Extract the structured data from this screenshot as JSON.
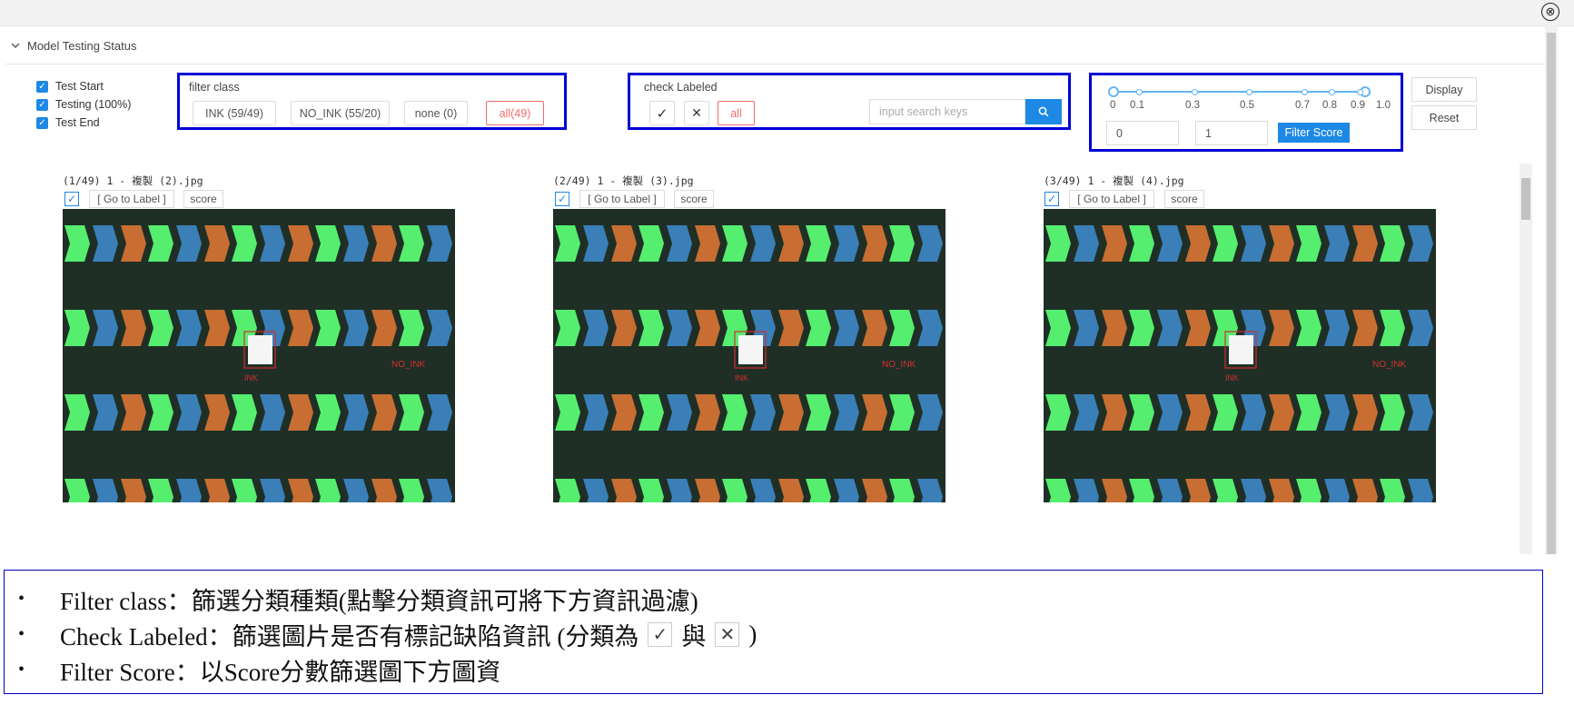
{
  "header": {
    "section_title": "Model Testing Status",
    "close_symbol": "⊗"
  },
  "status": {
    "items": [
      {
        "label": "Test Start",
        "checked": true
      },
      {
        "label": "Testing (100%)",
        "checked": true
      },
      {
        "label": "Test End",
        "checked": true
      }
    ]
  },
  "filter_class": {
    "label": "filter class",
    "buttons": [
      "INK (59/49)",
      "NO_INK (55/20)",
      "none (0)",
      "all(49)"
    ],
    "active_index": 3
  },
  "check_labeled": {
    "label": "check Labeled",
    "check_symbol": "✓",
    "cross_symbol": "✕",
    "all_label": "all",
    "search_placeholder": "input search keys"
  },
  "filter_score": {
    "ticks": [
      "0",
      "0.1",
      "0.3",
      "0.5",
      "0.7",
      "0.8",
      "0.9",
      "1.0"
    ],
    "range": [
      0,
      1
    ],
    "min_value": "0",
    "max_value": "1",
    "button_label": "Filter Score"
  },
  "actions": {
    "display_label": "Display",
    "reset_label": "Reset"
  },
  "images": [
    {
      "caption": "(1/49) 1 - 複製 (2).jpg",
      "go_label": "[ Go to Label ]",
      "score_label": "score",
      "box_label": "INK",
      "tag_label": "NO_INK"
    },
    {
      "caption": "(2/49) 1 - 複製 (3).jpg",
      "go_label": "[ Go to Label ]",
      "score_label": "score",
      "box_label": "INK",
      "tag_label": "NO_INK"
    },
    {
      "caption": "(3/49) 1 - 複製 (4).jpg",
      "go_label": "[ Go to Label ]",
      "score_label": "score",
      "box_label": "INK",
      "tag_label": "NO_INK"
    }
  ],
  "notes": {
    "bullet": "•",
    "line1": "Filter class：篩選分類種類(點擊分類資訊可將下方資訊過濾)",
    "line2_pre": "Check Labeled：篩選圖片是否有標記缺陷資訊 (分類為",
    "line2_check": "✓",
    "line2_mid": "與",
    "line2_cross": "✕",
    "line2_post": ")",
    "line3": "Filter Score：以Score分數篩選圖下方圖資"
  },
  "colors": {
    "accent": "#1e88e5",
    "active_red": "#f56c6c",
    "highlight_border": "#0000d6",
    "green_chevron": "#55ee6e",
    "blue_chevron": "#3a7fb8",
    "orange_chevron": "#c86e32"
  }
}
